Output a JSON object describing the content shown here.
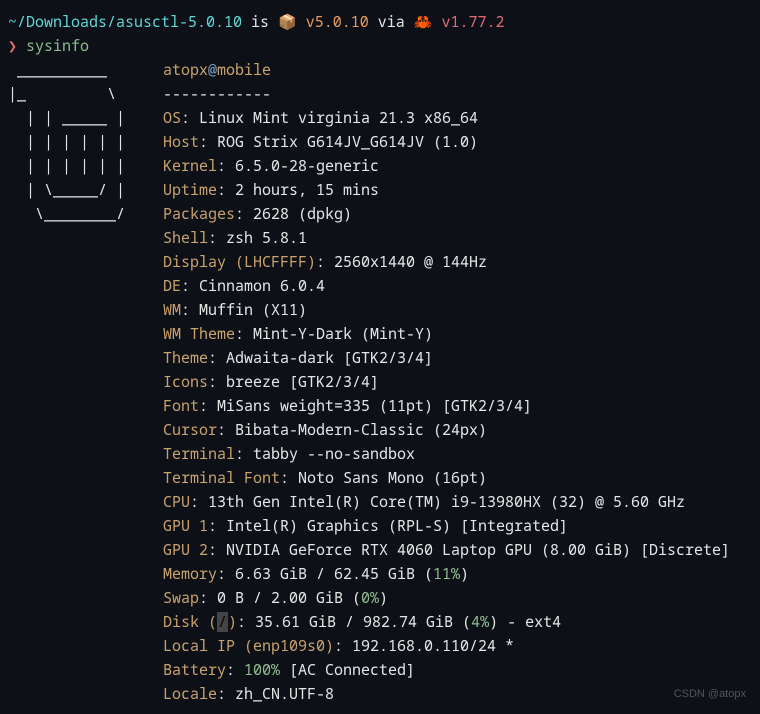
{
  "prompt": {
    "path": "~/Downloads/asusctl-5.0.10",
    "is": " is ",
    "pkg_emoji": "📦 ",
    "version1": "v5.0.10",
    "via": " via ",
    "crab_emoji": "🦀 ",
    "version2": "v1.77.2"
  },
  "command": {
    "indicator": "❯ ",
    "cmd": "sysinfo"
  },
  "logo": " __________\n|_         \\\n  | | _____ |\n  | | | | | |\n  | | | | | |\n  | \\_____/ |\n   \\________/",
  "user": {
    "name": "atopx",
    "at": "@",
    "host": "mobile"
  },
  "separator": "------------",
  "info": [
    {
      "label": "OS",
      "value": ": Linux Mint virginia 21.3 x86_64"
    },
    {
      "label": "Host",
      "value": ": ROG Strix G614JV_G614JV (1.0)"
    },
    {
      "label": "Kernel",
      "value": ": 6.5.0-28-generic"
    },
    {
      "label": "Uptime",
      "value": ": 2 hours, 15 mins"
    },
    {
      "label": "Packages",
      "value": ": 2628 (dpkg)"
    },
    {
      "label": "Shell",
      "value": ": zsh 5.8.1"
    },
    {
      "label": "Display (LHCFFFF)",
      "value": ": 2560x1440 @ 144Hz"
    },
    {
      "label": "DE",
      "value": ": Cinnamon 6.0.4"
    },
    {
      "label": "WM",
      "value": ": Muffin (X11)"
    },
    {
      "label": "WM Theme",
      "value": ": Mint-Y-Dark (Mint-Y)"
    },
    {
      "label": "Theme",
      "value": ": Adwaita-dark [GTK2/3/4]"
    },
    {
      "label": "Icons",
      "value": ": breeze [GTK2/3/4]"
    },
    {
      "label": "Font",
      "value": ": MiSans weight=335 (11pt) [GTK2/3/4]"
    },
    {
      "label": "Cursor",
      "value": ": Bibata-Modern-Classic (24px)"
    },
    {
      "label": "Terminal",
      "value": ": tabby --no-sandbox"
    },
    {
      "label": "Terminal Font",
      "value": ": Noto Sans Mono (16pt)"
    },
    {
      "label": "CPU",
      "value": ": 13th Gen Intel(R) Core(TM) i9-13980HX (32) @ 5.60 GHz"
    },
    {
      "label": "GPU 1",
      "value": ": Intel(R) Graphics (RPL-S) [Integrated]"
    },
    {
      "label": "GPU 2",
      "value": ": NVIDIA GeForce RTX 4060 Laptop GPU (8.00 GiB) [Discrete]"
    }
  ],
  "memory": {
    "label": "Memory",
    "prefix": ": 6.63 GiB / 62.45 GiB (",
    "pct": "11%",
    "suffix": ")"
  },
  "swap": {
    "label": "Swap",
    "prefix": ": 0 B / 2.00 GiB (",
    "pct": "0%",
    "suffix": ")"
  },
  "disk": {
    "label": "Disk (",
    "slash": "/",
    "label2": ")",
    "prefix": ": 35.61 GiB / 982.74 GiB (",
    "pct": "4%",
    "suffix": ") - ext4"
  },
  "localip": {
    "label": "Local IP (enp109s0)",
    "value": ": 192.168.0.110/24 *"
  },
  "battery": {
    "label": "Battery",
    "prefix": ": ",
    "pct": "100%",
    "suffix": " [AC Connected]"
  },
  "locale": {
    "label": "Locale",
    "value": ": zh_CN.UTF-8"
  },
  "watermark": "CSDN @atopx"
}
